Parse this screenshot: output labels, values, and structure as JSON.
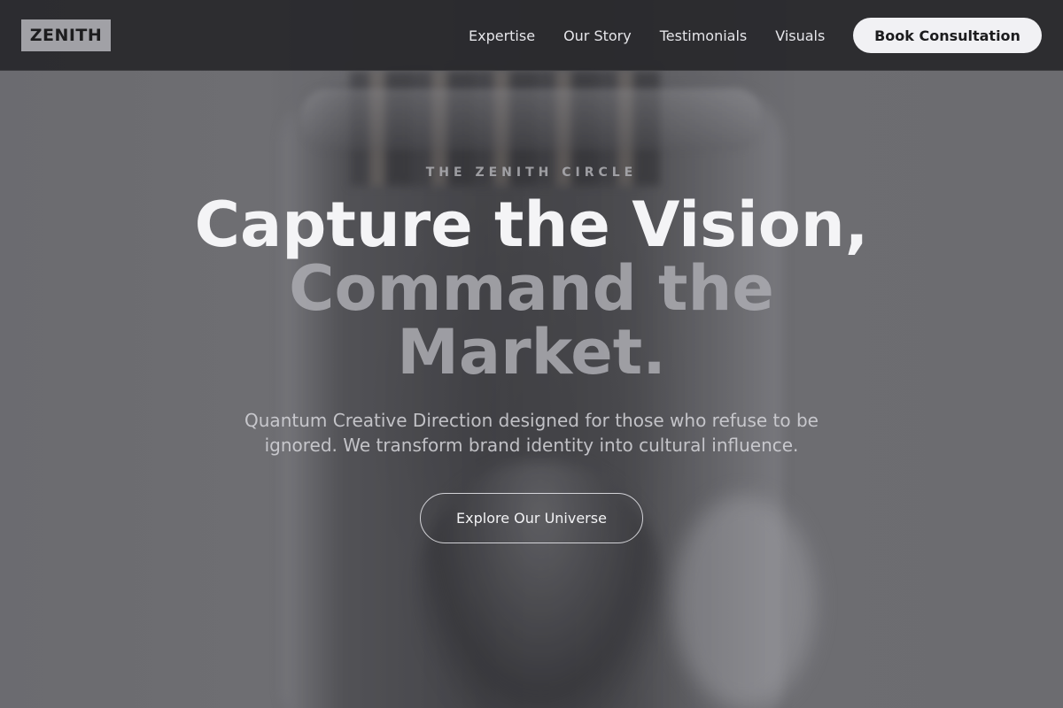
{
  "nav": {
    "logo": "ZENITH",
    "links": [
      {
        "label": "Expertise"
      },
      {
        "label": "Our Story"
      },
      {
        "label": "Testimonials"
      },
      {
        "label": "Visuals"
      }
    ],
    "cta_label": "Book Consultation"
  },
  "hero": {
    "eyebrow": "THE ZENITH CIRCLE",
    "headline_line1": "Capture the Vision,",
    "headline_line2": "Command the",
    "headline_line3": "Market.",
    "subtitle": "Quantum Creative Direction designed for those who refuse to be ignored. We transform brand identity into cultural influence.",
    "button_label": "Explore Our Universe"
  },
  "colors": {
    "nav_bg": "#28282b",
    "accent_light": "#f1f1f4",
    "logo_bg": "#a1a1a6",
    "muted_text": "#aaaaaf"
  }
}
